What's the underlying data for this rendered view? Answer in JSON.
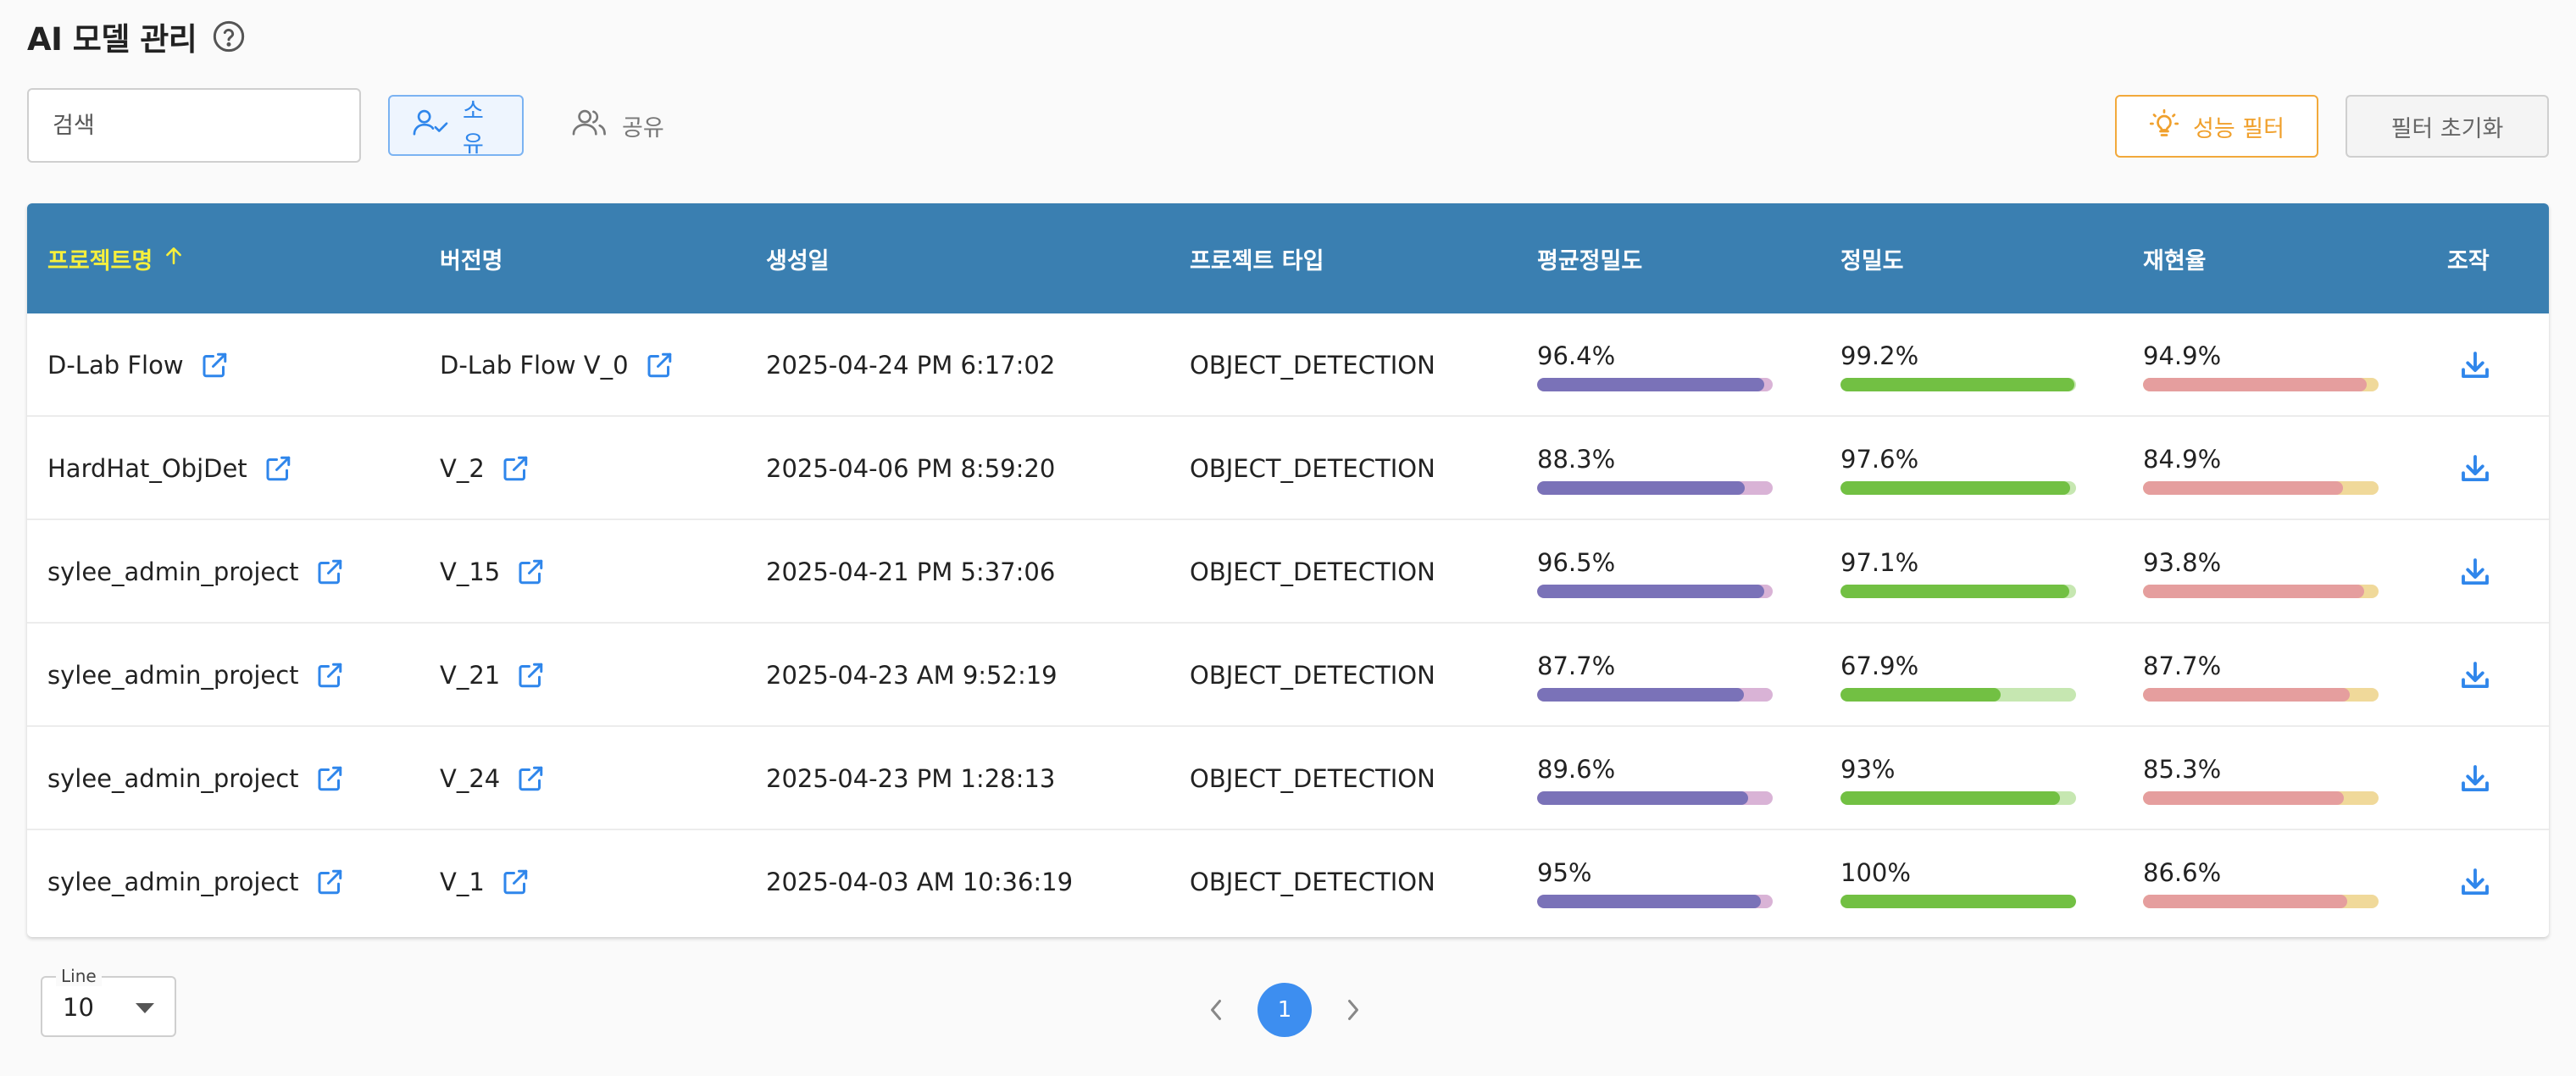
{
  "header": {
    "title": "AI 모델 관리"
  },
  "toolbar": {
    "search_placeholder": "검색",
    "own_label": "소유",
    "shared_label": "공유",
    "perf_filter_label": "성능 필터",
    "reset_filter_label": "필터 초기화"
  },
  "table": {
    "columns": {
      "project": "프로젝트명",
      "version": "버전명",
      "created": "생성일",
      "type": "프로젝트 타입",
      "ap": "평균정밀도",
      "precision": "정밀도",
      "recall": "재현율",
      "action": "조작"
    },
    "rows": [
      {
        "project": "D-Lab Flow",
        "version": "D-Lab Flow V_0",
        "created": "2025-04-24 PM 6:17:02",
        "type": "OBJECT_DETECTION",
        "ap": "96.4%",
        "ap_value": 96.4,
        "precision": "99.2%",
        "precision_value": 99.2,
        "recall": "94.9%",
        "recall_value": 94.9
      },
      {
        "project": "HardHat_ObjDet",
        "version": "V_2",
        "created": "2025-04-06 PM 8:59:20",
        "type": "OBJECT_DETECTION",
        "ap": "88.3%",
        "ap_value": 88.3,
        "precision": "97.6%",
        "precision_value": 97.6,
        "recall": "84.9%",
        "recall_value": 84.9
      },
      {
        "project": "sylee_admin_project",
        "version": "V_15",
        "created": "2025-04-21 PM 5:37:06",
        "type": "OBJECT_DETECTION",
        "ap": "96.5%",
        "ap_value": 96.5,
        "precision": "97.1%",
        "precision_value": 97.1,
        "recall": "93.8%",
        "recall_value": 93.8
      },
      {
        "project": "sylee_admin_project",
        "version": "V_21",
        "created": "2025-04-23 AM 9:52:19",
        "type": "OBJECT_DETECTION",
        "ap": "87.7%",
        "ap_value": 87.7,
        "precision": "67.9%",
        "precision_value": 67.9,
        "recall": "87.7%",
        "recall_value": 87.7
      },
      {
        "project": "sylee_admin_project",
        "version": "V_24",
        "created": "2025-04-23 PM 1:28:13",
        "type": "OBJECT_DETECTION",
        "ap": "89.6%",
        "ap_value": 89.6,
        "precision": "93%",
        "precision_value": 93,
        "recall": "85.3%",
        "recall_value": 85.3
      },
      {
        "project": "sylee_admin_project",
        "version": "V_1",
        "created": "2025-04-03 AM 10:36:19",
        "type": "OBJECT_DETECTION",
        "ap": "95%",
        "ap_value": 95,
        "precision": "100%",
        "precision_value": 100,
        "recall": "86.6%",
        "recall_value": 86.6
      }
    ]
  },
  "footer": {
    "line_label": "Line",
    "line_value": "10",
    "current_page": "1"
  },
  "icons": {
    "help": "help-circle-icon",
    "own": "user-check-icon",
    "shared": "users-icon",
    "perf": "lightbulb-icon",
    "link": "external-link-icon",
    "download": "download-icon",
    "sort": "arrow-up-icon"
  },
  "colors": {
    "header_bg": "#3a7fb1",
    "sorted_header": "#f6ef3d",
    "accent_blue": "#2f86eb",
    "perf_orange": "#f0a02c",
    "ap_bar": "#7a72b8",
    "precision_bar": "#72c043",
    "recall_bar": "#e59e9e"
  }
}
